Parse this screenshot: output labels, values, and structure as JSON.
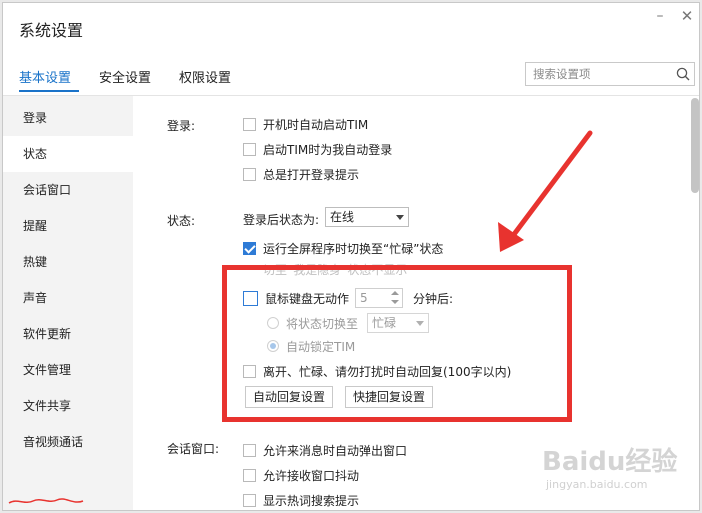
{
  "window": {
    "title": "系统设置"
  },
  "tabs": [
    {
      "label": "基本设置"
    },
    {
      "label": "安全设置"
    },
    {
      "label": "权限设置"
    }
  ],
  "search": {
    "placeholder": "搜索设置项"
  },
  "sidebar": {
    "items": [
      {
        "label": "登录"
      },
      {
        "label": "状态"
      },
      {
        "label": "会话窗口"
      },
      {
        "label": "提醒"
      },
      {
        "label": "热键"
      },
      {
        "label": "声音"
      },
      {
        "label": "软件更新"
      },
      {
        "label": "文件管理"
      },
      {
        "label": "文件共享"
      },
      {
        "label": "音视频通话"
      }
    ]
  },
  "login": {
    "label": "登录:",
    "options": [
      {
        "label": "开机时自动启动TIM",
        "checked": false
      },
      {
        "label": "启动TIM时为我自动登录",
        "checked": false
      },
      {
        "label": "总是打开登录提示",
        "checked": false
      }
    ]
  },
  "status": {
    "label": "状态:",
    "after_login_label": "登录后状态为:",
    "after_login_value": "在线",
    "fullscreen": {
      "label": "运行全屏程序时切换至“忙碌”状态",
      "checked": true
    },
    "faded_hint": "切至“我是隐身”状态不显示",
    "idle": {
      "label": "鼠标键盘无动作",
      "checked": false,
      "minutes": "5",
      "suffix": "分钟后:"
    },
    "switch_to": {
      "label": "将状态切换至",
      "value": "忙碌",
      "selected": false
    },
    "auto_lock": {
      "label": "自动锁定TIM",
      "selected": true
    },
    "auto_reply": {
      "label": "离开、忙碌、请勿打扰时自动回复(100字以内)",
      "checked": false
    },
    "buttons": {
      "auto_reply_settings": "自动回复设置",
      "quick_reply_settings": "快捷回复设置"
    }
  },
  "session": {
    "label": "会话窗口:",
    "options": [
      {
        "label": "允许来消息时自动弹出窗口",
        "checked": false
      },
      {
        "label": "允许接收窗口抖动",
        "checked": false
      },
      {
        "label": "显示热词搜索提示",
        "checked": false
      }
    ]
  },
  "watermark": {
    "brand": "Baidu经验",
    "url": "jingyan.baidu.com"
  },
  "colors": {
    "accent": "#1a73c9",
    "highlight": "#e8332f",
    "checkbox_checked": "#2e7bd6"
  },
  "icons": {
    "search": "search-icon",
    "minimize": "minimize-icon",
    "close": "close-icon",
    "arrow": "annotation-arrow"
  }
}
